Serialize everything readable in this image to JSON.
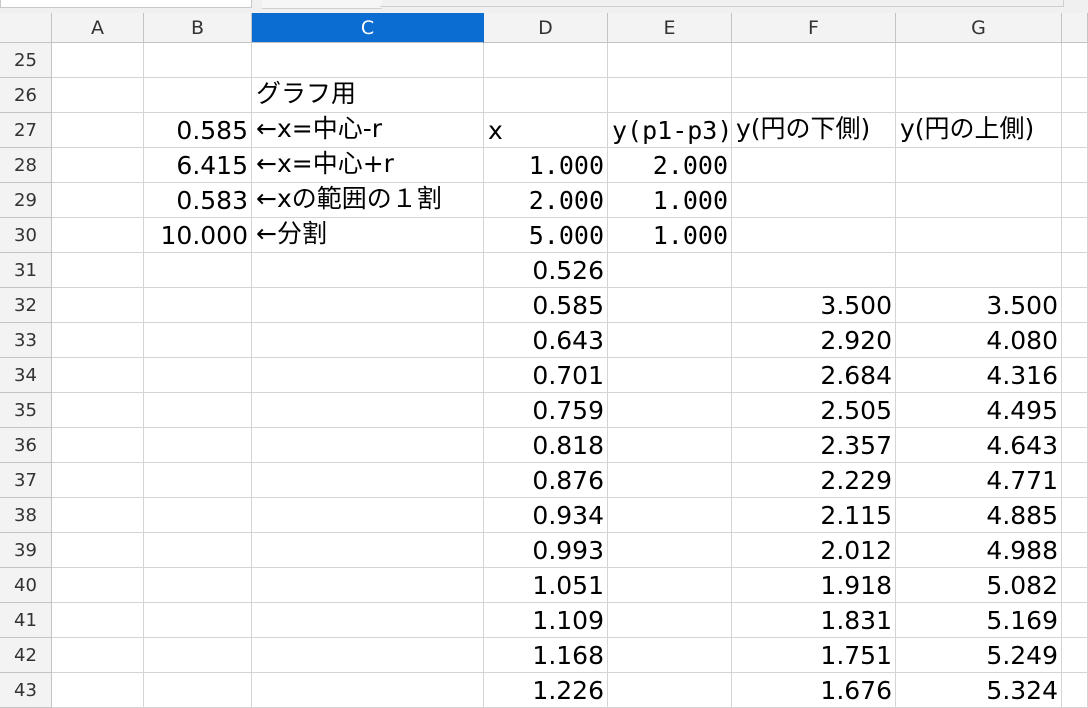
{
  "columns": [
    "A",
    "B",
    "C",
    "D",
    "E",
    "F",
    "G"
  ],
  "selected_column": "C",
  "rows": [
    {
      "num": "25",
      "B": "",
      "C": "",
      "D": "",
      "E": "",
      "F": "",
      "G": ""
    },
    {
      "num": "26",
      "B": "",
      "C": "グラフ用",
      "D": "",
      "E": "",
      "F": "",
      "G": ""
    },
    {
      "num": "27",
      "B": "0.585",
      "C": "←x=中心-r",
      "D": "x",
      "E": "y(p1-p3)",
      "F": "y(円の下側)",
      "G": "y(円の上側)"
    },
    {
      "num": "28",
      "B": "6.415",
      "C": "←x=中心+r",
      "D": "1.000",
      "E": "2.000",
      "F": "",
      "G": ""
    },
    {
      "num": "29",
      "B": "0.583",
      "C": "←xの範囲の１割",
      "D": "2.000",
      "E": "1.000",
      "F": "",
      "G": ""
    },
    {
      "num": "30",
      "B": "10.000",
      "C": "←分割",
      "D": "5.000",
      "E": "1.000",
      "F": "",
      "G": ""
    },
    {
      "num": "31",
      "B": "",
      "C": "",
      "D": "0.526",
      "E": "",
      "F": "",
      "G": ""
    },
    {
      "num": "32",
      "B": "",
      "C": "",
      "D": "0.585",
      "E": "",
      "F": "3.500",
      "G": "3.500"
    },
    {
      "num": "33",
      "B": "",
      "C": "",
      "D": "0.643",
      "E": "",
      "F": "2.920",
      "G": "4.080"
    },
    {
      "num": "34",
      "B": "",
      "C": "",
      "D": "0.701",
      "E": "",
      "F": "2.684",
      "G": "4.316"
    },
    {
      "num": "35",
      "B": "",
      "C": "",
      "D": "0.759",
      "E": "",
      "F": "2.505",
      "G": "4.495"
    },
    {
      "num": "36",
      "B": "",
      "C": "",
      "D": "0.818",
      "E": "",
      "F": "2.357",
      "G": "4.643"
    },
    {
      "num": "37",
      "B": "",
      "C": "",
      "D": "0.876",
      "E": "",
      "F": "2.229",
      "G": "4.771"
    },
    {
      "num": "38",
      "B": "",
      "C": "",
      "D": "0.934",
      "E": "",
      "F": "2.115",
      "G": "4.885"
    },
    {
      "num": "39",
      "B": "",
      "C": "",
      "D": "0.993",
      "E": "",
      "F": "2.012",
      "G": "4.988"
    },
    {
      "num": "40",
      "B": "",
      "C": "",
      "D": "1.051",
      "E": "",
      "F": "1.918",
      "G": "5.082"
    },
    {
      "num": "41",
      "B": "",
      "C": "",
      "D": "1.109",
      "E": "",
      "F": "1.831",
      "G": "5.169"
    },
    {
      "num": "42",
      "B": "",
      "C": "",
      "D": "1.168",
      "E": "",
      "F": "1.751",
      "G": "5.249"
    },
    {
      "num": "43",
      "B": "",
      "C": "",
      "D": "1.226",
      "E": "",
      "F": "1.676",
      "G": "5.324"
    }
  ],
  "colors": {
    "selected_header": "#0b6cd1",
    "gridline": "#d4d4d4",
    "header_bg": "#f3f3f3"
  }
}
